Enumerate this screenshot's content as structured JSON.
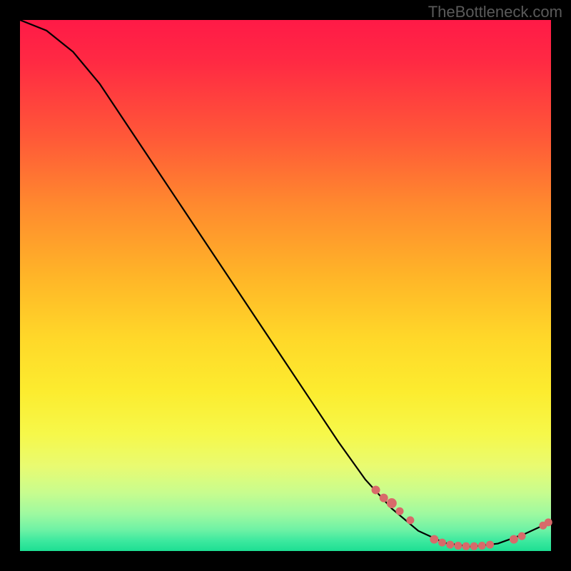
{
  "attribution": "TheBottleneck.com",
  "chart_data": {
    "type": "line",
    "title": "",
    "xlabel": "",
    "ylabel": "",
    "xlim": [
      0,
      100
    ],
    "ylim": [
      0,
      100
    ],
    "curve": [
      {
        "x": 0,
        "y": 100
      },
      {
        "x": 5,
        "y": 98
      },
      {
        "x": 10,
        "y": 94
      },
      {
        "x": 15,
        "y": 88
      },
      {
        "x": 20,
        "y": 80.5
      },
      {
        "x": 25,
        "y": 73
      },
      {
        "x": 30,
        "y": 65.5
      },
      {
        "x": 35,
        "y": 58
      },
      {
        "x": 40,
        "y": 50.5
      },
      {
        "x": 45,
        "y": 43
      },
      {
        "x": 50,
        "y": 35.5
      },
      {
        "x": 55,
        "y": 28
      },
      {
        "x": 60,
        "y": 20.5
      },
      {
        "x": 65,
        "y": 13.5
      },
      {
        "x": 70,
        "y": 8
      },
      {
        "x": 75,
        "y": 3.8
      },
      {
        "x": 80,
        "y": 1.5
      },
      {
        "x": 85,
        "y": 0.8
      },
      {
        "x": 90,
        "y": 1.4
      },
      {
        "x": 95,
        "y": 3.2
      },
      {
        "x": 100,
        "y": 5.5
      }
    ],
    "scatter_clusters": [
      {
        "x": 67,
        "y": 11.5,
        "r": 6,
        "color": "#d86a6a"
      },
      {
        "x": 68.5,
        "y": 10,
        "r": 6,
        "color": "#d86a6a"
      },
      {
        "x": 70,
        "y": 9,
        "r": 7,
        "color": "#d86a6a"
      },
      {
        "x": 71.5,
        "y": 7.5,
        "r": 5.5,
        "color": "#d86a6a"
      },
      {
        "x": 73.5,
        "y": 5.8,
        "r": 5.5,
        "color": "#d86a6a"
      },
      {
        "x": 78,
        "y": 2.2,
        "r": 6,
        "color": "#d86a6a"
      },
      {
        "x": 79.5,
        "y": 1.6,
        "r": 5.5,
        "color": "#d86a6a"
      },
      {
        "x": 81,
        "y": 1.2,
        "r": 5.5,
        "color": "#d86a6a"
      },
      {
        "x": 82.5,
        "y": 1.0,
        "r": 5.5,
        "color": "#d86a6a"
      },
      {
        "x": 84,
        "y": 0.9,
        "r": 5.5,
        "color": "#d86a6a"
      },
      {
        "x": 85.5,
        "y": 0.9,
        "r": 5.5,
        "color": "#d86a6a"
      },
      {
        "x": 87,
        "y": 1.0,
        "r": 5.5,
        "color": "#d86a6a"
      },
      {
        "x": 88.5,
        "y": 1.2,
        "r": 5.5,
        "color": "#d86a6a"
      },
      {
        "x": 93,
        "y": 2.2,
        "r": 6,
        "color": "#d86a6a"
      },
      {
        "x": 94.5,
        "y": 2.8,
        "r": 5.5,
        "color": "#d86a6a"
      },
      {
        "x": 98.5,
        "y": 4.8,
        "r": 5.5,
        "color": "#d86a6a"
      },
      {
        "x": 99.5,
        "y": 5.4,
        "r": 5.5,
        "color": "#d86a6a"
      }
    ],
    "colors": {
      "curve": "#000000",
      "scatter": "#d86a6a",
      "gradient_top": "#ff1a47",
      "gradient_bottom": "#1ddf93"
    }
  }
}
